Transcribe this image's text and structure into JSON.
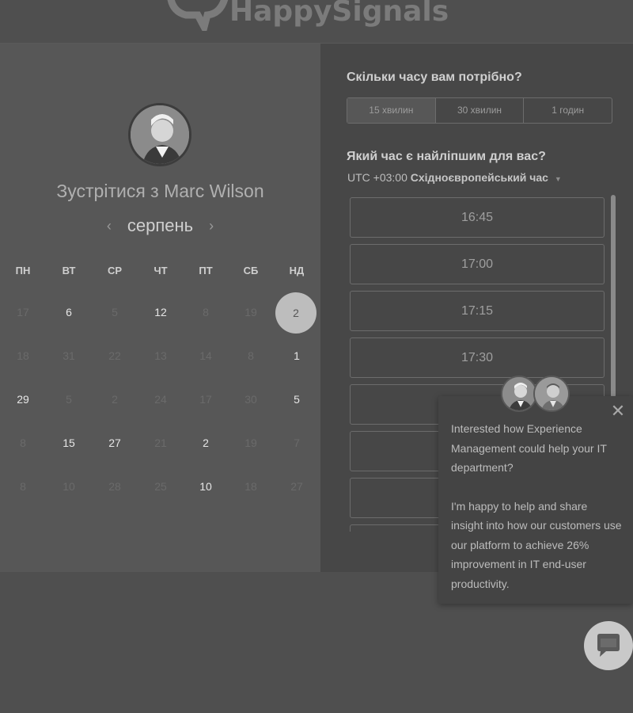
{
  "brand": {
    "name": "HappySignals"
  },
  "booking": {
    "title": "Зустрітися з Marc Wilson",
    "month": "серпень",
    "prev_icon": "chevron-left-icon",
    "next_icon": "chevron-right-icon",
    "weekdays": [
      "ПН",
      "ВТ",
      "СР",
      "ЧТ",
      "ПТ",
      "СБ",
      "НД"
    ],
    "weeks": [
      [
        "17",
        "6",
        "5",
        "12",
        "8",
        "19",
        "2"
      ],
      [
        "18",
        "31",
        "22",
        "13",
        "14",
        "8",
        "1"
      ],
      [
        "29",
        "5",
        "2",
        "24",
        "17",
        "30",
        "5"
      ],
      [
        "8",
        "15",
        "27",
        "21",
        "2",
        "19",
        "7"
      ],
      [
        "8",
        "10",
        "28",
        "25",
        "10",
        "18",
        "27"
      ]
    ],
    "selected_day": "2"
  },
  "duration": {
    "question": "Скільки часу вам потрібно?",
    "options": [
      "15 хвилин",
      "30 хвилин",
      "1 годин"
    ],
    "selected": "15 хвилин"
  },
  "time": {
    "question": "Який час є найліпшим для вас?",
    "timezone_offset": "UTC +03:00",
    "timezone_name": "Східноєвропейський час",
    "slots": [
      "16:45",
      "17:00",
      "17:15",
      "17:30",
      "",
      "",
      "",
      ""
    ]
  },
  "chat": {
    "message_1": "Interested how Experience Management could help your IT department?",
    "message_2": "I'm happy to help and share insight into how our customers use our platform to achieve 26% improvement in IT end-user productivity.",
    "close_icon": "close-icon",
    "launcher_icon": "chat-bubble-icon"
  }
}
